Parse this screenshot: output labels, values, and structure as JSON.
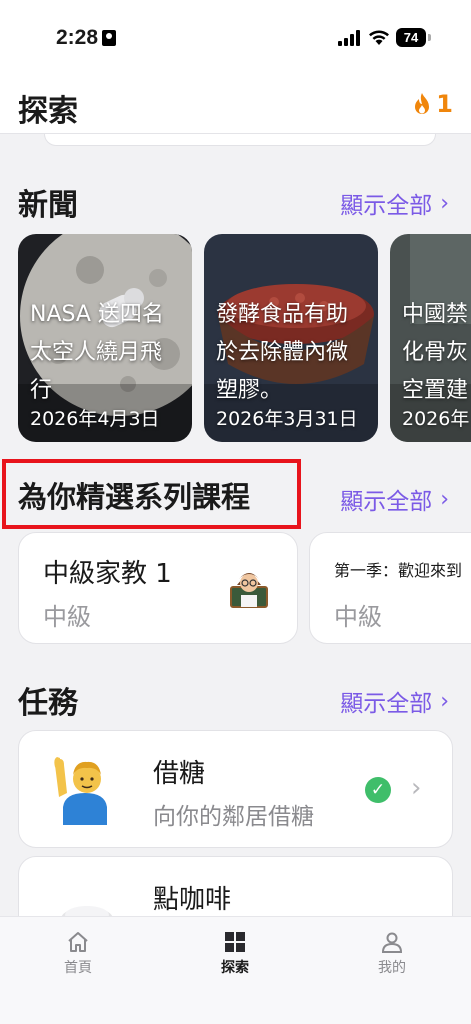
{
  "status": {
    "time": "2:28",
    "battery": "74"
  },
  "header": {
    "title": "探索",
    "streak_count": "1",
    "streak_icon": "flame-icon",
    "accent_color": "#f0860c"
  },
  "news": {
    "title": "新聞",
    "show_all": "顯示全部",
    "items": [
      {
        "text": "NASA 送四名太空人繞月飛行",
        "date": "2026年4月3日"
      },
      {
        "text": "發酵食品有助於去除體內微塑膠。",
        "date": "2026年3月31日"
      },
      {
        "text": "中國禁化骨灰空置建",
        "date": "2026年"
      }
    ]
  },
  "courses": {
    "title": "為你精選系列課程",
    "show_all": "顯示全部",
    "items": [
      {
        "title": "中級家教 1",
        "level": "中級",
        "icon": "teacher-avatar-icon"
      },
      {
        "title": "第一季：歡迎來到",
        "level": "中級"
      }
    ]
  },
  "tasks": {
    "title": "任務",
    "show_all": "顯示全部",
    "items": [
      {
        "title": "借糖",
        "subtitle": "向你的鄰居借糖",
        "completed": true,
        "icon": "waving-person-icon"
      },
      {
        "title": "點咖啡",
        "subtitle": "",
        "icon": "chef-icon"
      }
    ]
  },
  "tabbar": {
    "items": [
      {
        "label": "首頁",
        "icon": "home-icon"
      },
      {
        "label": "探索",
        "icon": "grid-icon",
        "active": true
      },
      {
        "label": "我的",
        "icon": "profile-icon"
      }
    ]
  },
  "colors": {
    "link": "#7b5ae6",
    "highlight_box": "#e8141c",
    "check": "#3fbe6a"
  }
}
